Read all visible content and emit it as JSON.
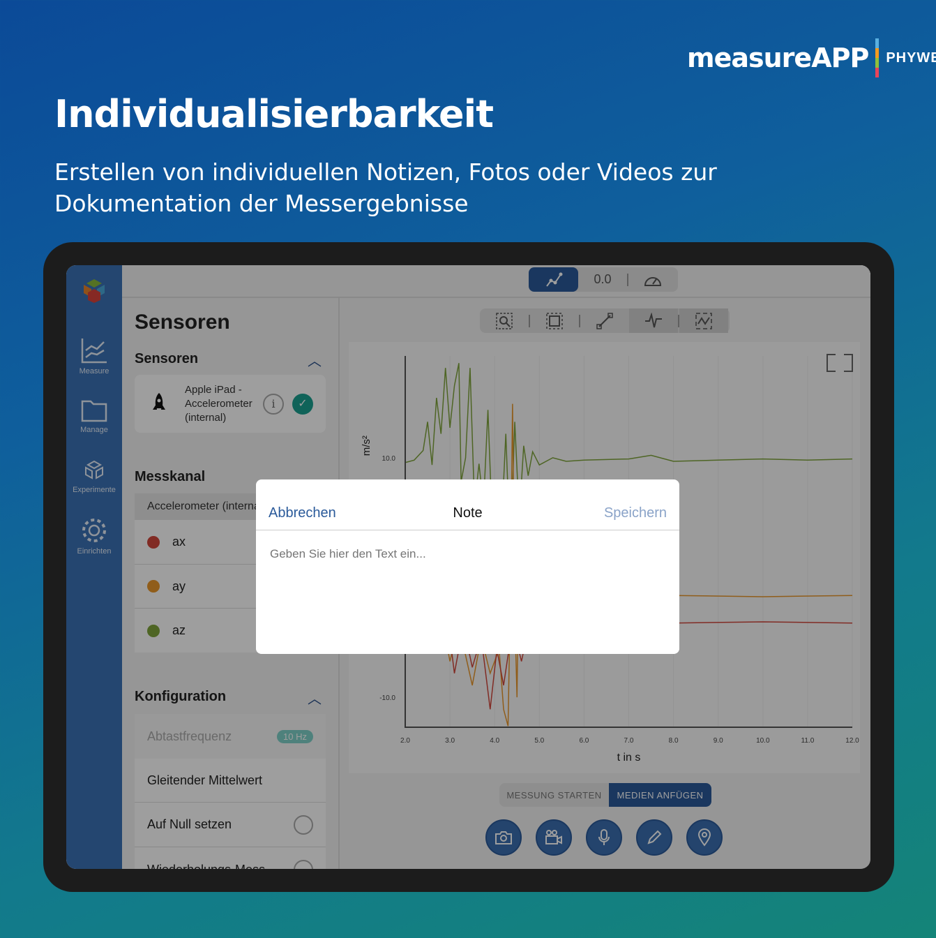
{
  "brand": {
    "app": "measureAPP",
    "company": "PHYWE"
  },
  "headline": "Individualisierbarkeit",
  "subtitle": "Erstellen von individuellen Notizen, Fotos oder Videos zur Dokumentation der Messergebnisse",
  "sidebar": {
    "items": [
      {
        "label": "Measure",
        "icon": "chart-icon"
      },
      {
        "label": "Manage",
        "icon": "folder-icon"
      },
      {
        "label": "Experimente",
        "icon": "cubes-icon"
      },
      {
        "label": "Einrichten",
        "icon": "gear-icon"
      }
    ]
  },
  "topbar": {
    "value": "0.0"
  },
  "panel": {
    "title": "Sensoren",
    "sensors_header": "Sensoren",
    "sensor_name": "Apple iPad - Accelerometer (internal)",
    "channel_header": "Messkanal",
    "channel_group": "Accelerometer (internal)",
    "channels": [
      {
        "label": "ax",
        "color": "#d0463a"
      },
      {
        "label": "ay",
        "color": "#e8962a"
      },
      {
        "label": "az",
        "color": "#7ea33a"
      }
    ],
    "config_header": "Konfiguration",
    "sample_rate_label": "Abtastfrequenz",
    "sample_rate_value": "10 Hz",
    "moving_avg": "Gleitender Mittelwert",
    "zero": "Auf Null setzen",
    "repeat": "Wiederholungs-Mess..."
  },
  "actions": {
    "start": "MESSUNG STARTEN",
    "attach": "MEDIEN ANFÜGEN"
  },
  "modal": {
    "cancel": "Abbrechen",
    "title": "Note",
    "save": "Speichern",
    "placeholder": "Geben Sie hier den Text ein..."
  },
  "chart_data": {
    "type": "line",
    "xlabel": "t in s",
    "ylabel": "m/s²",
    "xlim": [
      2,
      12
    ],
    "ylim": [
      -12.5,
      18.5
    ],
    "xticks": [
      "2.0",
      "3.0",
      "4.0",
      "5.0",
      "6.0",
      "7.0",
      "8.0",
      "9.0",
      "10.0",
      "11.0",
      "12.0"
    ],
    "yticks": [
      {
        "v": 10,
        "label": "10.0"
      },
      {
        "v": -10,
        "label": "-10.0"
      }
    ],
    "series": [
      {
        "name": "az",
        "color": "#7ea33a",
        "points": [
          [
            2,
            9.6
          ],
          [
            2.2,
            9.8
          ],
          [
            2.4,
            10.6
          ],
          [
            2.5,
            13
          ],
          [
            2.6,
            9.4
          ],
          [
            2.7,
            15
          ],
          [
            2.8,
            12
          ],
          [
            2.9,
            17.5
          ],
          [
            3,
            12.5
          ],
          [
            3.1,
            16
          ],
          [
            3.2,
            17.9
          ],
          [
            3.25,
            8
          ],
          [
            3.35,
            10
          ],
          [
            3.45,
            17.5
          ],
          [
            3.55,
            6
          ],
          [
            3.65,
            9.5
          ],
          [
            3.75,
            6
          ],
          [
            3.85,
            14
          ],
          [
            3.95,
            4
          ],
          [
            4.05,
            7
          ],
          [
            4.15,
            4
          ],
          [
            4.25,
            12
          ],
          [
            4.35,
            2
          ],
          [
            4.45,
            13
          ],
          [
            4.55,
            5
          ],
          [
            4.65,
            11
          ],
          [
            4.75,
            8.5
          ],
          [
            4.85,
            10.5
          ],
          [
            5,
            9.4
          ],
          [
            5.3,
            10
          ],
          [
            5.6,
            9.7
          ],
          [
            6,
            9.8
          ],
          [
            7,
            9.9
          ],
          [
            7.5,
            10.2
          ],
          [
            8,
            9.7
          ],
          [
            9,
            9.8
          ],
          [
            10,
            9.9
          ],
          [
            11,
            9.8
          ],
          [
            12,
            9.9
          ]
        ]
      },
      {
        "name": "ay",
        "color": "#e8962a",
        "points": [
          [
            2,
            -1.6
          ],
          [
            2.5,
            -1.7
          ],
          [
            2.8,
            -3
          ],
          [
            3,
            -7
          ],
          [
            3.2,
            -4
          ],
          [
            3.5,
            -9
          ],
          [
            3.7,
            -5
          ],
          [
            3.9,
            -8
          ],
          [
            4.1,
            -6
          ],
          [
            4.2,
            -11
          ],
          [
            4.3,
            -12.4
          ],
          [
            4.35,
            -2
          ],
          [
            4.4,
            14.5
          ],
          [
            4.45,
            -3
          ],
          [
            4.5,
            -10
          ],
          [
            4.55,
            4
          ],
          [
            4.6,
            -6
          ],
          [
            4.7,
            -1
          ],
          [
            4.9,
            -2
          ],
          [
            5.2,
            -1.5
          ],
          [
            6,
            -1.6
          ],
          [
            8,
            -1.5
          ],
          [
            10,
            -1.6
          ],
          [
            12,
            -1.5
          ]
        ]
      },
      {
        "name": "ax",
        "color": "#d0463a",
        "points": [
          [
            2,
            -3.7
          ],
          [
            2.6,
            -3.8
          ],
          [
            2.8,
            -6
          ],
          [
            3,
            -5
          ],
          [
            3.1,
            -8
          ],
          [
            3.3,
            -4
          ],
          [
            3.5,
            -7.5
          ],
          [
            3.7,
            -5
          ],
          [
            3.9,
            -11
          ],
          [
            4.05,
            -6
          ],
          [
            4.2,
            -9
          ],
          [
            4.4,
            -4
          ],
          [
            4.6,
            -7
          ],
          [
            4.8,
            -3.5
          ],
          [
            5.2,
            -3.8
          ],
          [
            6,
            -3.7
          ],
          [
            8,
            -3.8
          ],
          [
            10,
            -3.7
          ],
          [
            12,
            -3.8
          ]
        ]
      }
    ]
  }
}
